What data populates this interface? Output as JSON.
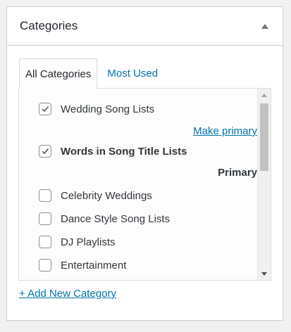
{
  "box": {
    "title": "Categories"
  },
  "tabs": [
    {
      "label": "All Categories",
      "active": true
    },
    {
      "label": "Most Used",
      "active": false
    }
  ],
  "categories": [
    {
      "label": "Wedding Song Lists",
      "checked": true,
      "bold": false,
      "primary_action": "Make primary"
    },
    {
      "label": "Words in Song Title Lists",
      "checked": true,
      "bold": true,
      "primary_status": "Primary"
    },
    {
      "label": "Celebrity Weddings",
      "checked": false
    },
    {
      "label": "Dance Style Song Lists",
      "checked": false
    },
    {
      "label": "DJ Playlists",
      "checked": false
    },
    {
      "label": "Entertainment",
      "checked": false
    }
  ],
  "add_new_label": "+ Add New Category",
  "colors": {
    "link": "#0073aa",
    "text": "#32373c",
    "border": "#ccd0d4"
  }
}
